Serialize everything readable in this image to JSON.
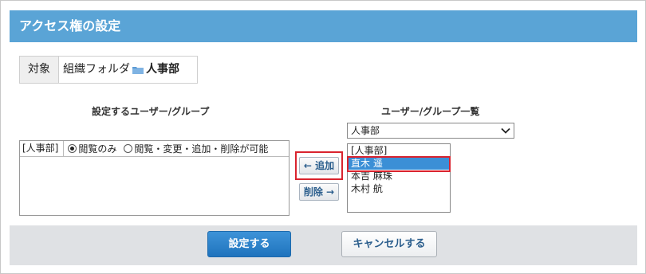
{
  "dialog": {
    "title": "アクセス権の設定"
  },
  "target": {
    "label": "対象",
    "path_prefix": "組織フォルダ",
    "folder_name": "人事部"
  },
  "assigned": {
    "heading": "設定するユーザー/グループ",
    "rows": [
      {
        "name": "[人事部]",
        "option_read": "閲覧のみ",
        "option_full": "閲覧・変更・追加・削除が可能",
        "selected": "read"
      }
    ]
  },
  "actions": {
    "add_label": "← 追加",
    "remove_label": "削除 →"
  },
  "candidates": {
    "heading": "ユーザー/グループ一覧",
    "group_select_value": "人事部",
    "items": [
      "[人事部]",
      "直木 遥",
      "本吉 麻珠",
      "木村 航"
    ],
    "selected_index": 1
  },
  "footer": {
    "submit_label": "設定する",
    "cancel_label": "キャンセルする"
  },
  "colors": {
    "title_bar": "#5aa4d6",
    "primary": "#1f73bd",
    "highlight": "#d9232e",
    "selection": "#3b8fd6"
  }
}
